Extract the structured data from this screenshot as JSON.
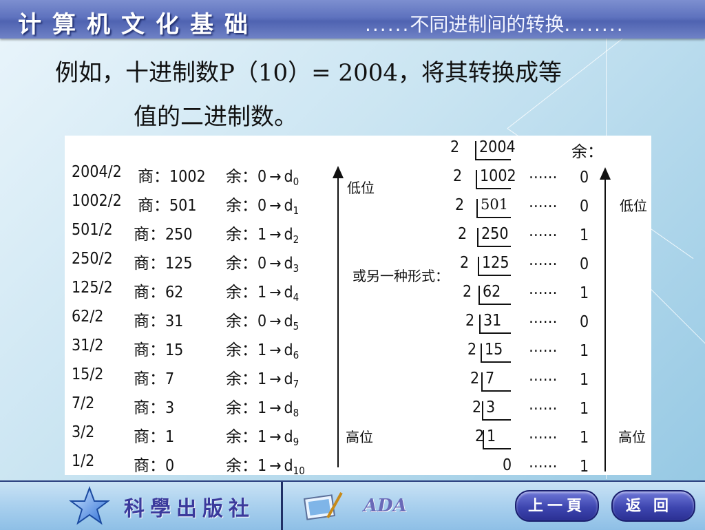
{
  "header": {
    "title": "计算机文化基础",
    "subtitle_dots_left": "......",
    "subtitle": "不同进制间的转换",
    "subtitle_dots_right": "........"
  },
  "intro": {
    "line1": "例如，十进制数P（10）= 2004，将其转换成等",
    "line2": "值的二进制数。"
  },
  "left_table": {
    "rows": [
      {
        "division": "2004/2",
        "quotient_label": "商：1002",
        "remainder": "余：0",
        "digit": "d",
        "index": "0"
      },
      {
        "division": "1002/2",
        "quotient_label": "商：501",
        "remainder": "余：0",
        "digit": "d",
        "index": "1"
      },
      {
        "division": "501/2",
        "quotient_label": "商：250",
        "remainder": "余：1",
        "digit": "d",
        "index": "2"
      },
      {
        "division": "250/2",
        "quotient_label": "商：125",
        "remainder": "余：0",
        "digit": "d",
        "index": "3"
      },
      {
        "division": "125/2",
        "quotient_label": "商：62",
        "remainder": "余：1",
        "digit": "d",
        "index": "4"
      },
      {
        "division": "62/2",
        "quotient_label": "商：31",
        "remainder": "余：0",
        "digit": "d",
        "index": "5"
      },
      {
        "division": "31/2",
        "quotient_label": "商：15",
        "remainder": "余：1",
        "digit": "d",
        "index": "6"
      },
      {
        "division": "15/2",
        "quotient_label": "商：7",
        "remainder": "余：1",
        "digit": "d",
        "index": "7"
      },
      {
        "division": "7/2",
        "quotient_label": "商：3",
        "remainder": "余：1",
        "digit": "d",
        "index": "8"
      },
      {
        "division": "3/2",
        "quotient_label": "商：1",
        "remainder": "余：1",
        "digit": "d",
        "index": "9"
      },
      {
        "division": "1/2",
        "quotient_label": "商：0",
        "remainder": "余：1",
        "digit": "d",
        "index": "10"
      }
    ],
    "arrow_symbol": "→",
    "low_label": "低位",
    "high_label": "高位"
  },
  "alt_form_label": "或另一种形式：",
  "right_table": {
    "remainder_header": "余：",
    "rows": [
      {
        "divisor": "2",
        "dividend": "2004",
        "dots": "",
        "rem": ""
      },
      {
        "divisor": "2",
        "dividend": "1002",
        "dots": "……",
        "rem": "0"
      },
      {
        "divisor": "2",
        "dividend": "501",
        "dots": "……",
        "rem": "0"
      },
      {
        "divisor": "2",
        "dividend": "250",
        "dots": "……",
        "rem": "1"
      },
      {
        "divisor": "2",
        "dividend": "125",
        "dots": "……",
        "rem": "0"
      },
      {
        "divisor": "2",
        "dividend": "62",
        "dots": "……",
        "rem": "1"
      },
      {
        "divisor": "2",
        "dividend": "31",
        "dots": "……",
        "rem": "0"
      },
      {
        "divisor": "2",
        "dividend": "15",
        "dots": "……",
        "rem": "1"
      },
      {
        "divisor": "2",
        "dividend": "7",
        "dots": "……",
        "rem": "1"
      },
      {
        "divisor": "2",
        "dividend": "3",
        "dots": "……",
        "rem": "1"
      },
      {
        "divisor": "2",
        "dividend": "1",
        "dots": "……",
        "rem": "1"
      },
      {
        "divisor": "",
        "dividend": "0",
        "dots": "……",
        "rem": "1"
      }
    ],
    "low_label": "低位",
    "high_label": "高位"
  },
  "footer": {
    "publisher": "科學出版社",
    "logo_text": "ADA",
    "prev_button": "上一頁",
    "back_button": "返回"
  },
  "colors": {
    "header": "#5e72be",
    "button": "#3e46b0",
    "publisher_text": "#3b3a9c"
  }
}
